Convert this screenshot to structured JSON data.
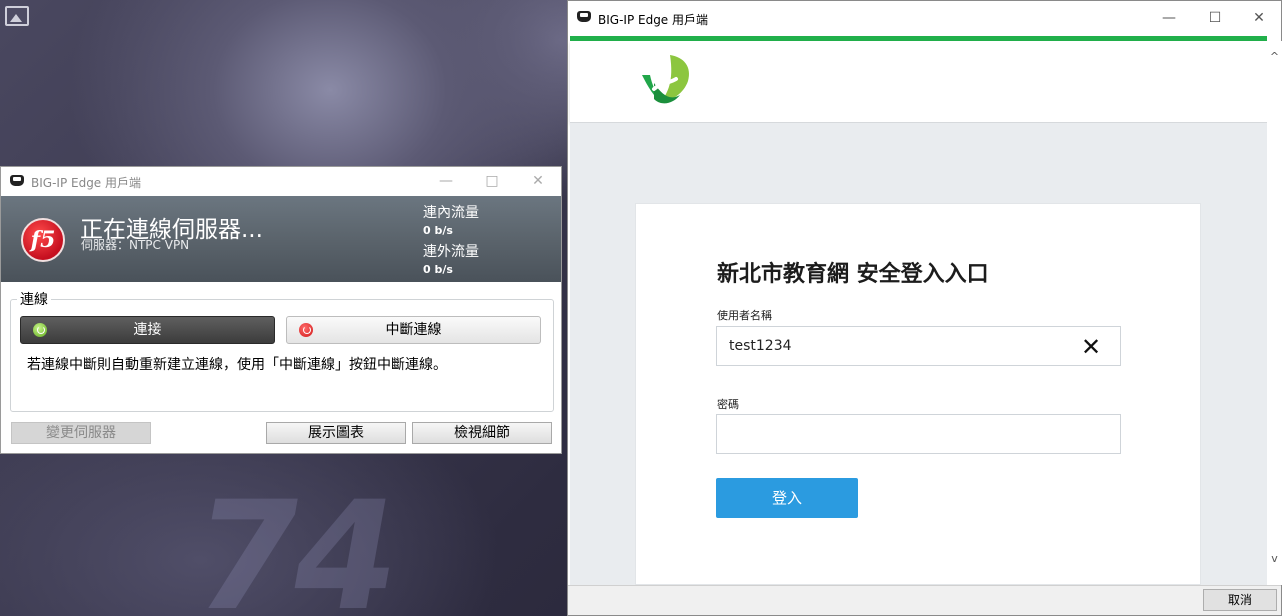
{
  "f5_window": {
    "title": "BIG-IP Edge 用戶端",
    "controls": {
      "minimize": "—",
      "maximize": "□",
      "close": "✕"
    },
    "logo_text": "f5",
    "status": "正在連線伺服器...",
    "server": "伺服器：NTPC VPN",
    "traffic": {
      "in_label": "連內流量",
      "in_value": "0 b/s",
      "out_label": "連外流量",
      "out_value": "0 b/s"
    },
    "group_label": "連線",
    "connect_label": "連接",
    "disconnect_label": "中斷連線",
    "note": "若連線中斷則自動重新建立連線，使用「中斷連線」按鈕中斷連線。",
    "buttons": {
      "change_server": "變更伺服器",
      "show_chart": "展示圖表",
      "view_details": "檢視細節"
    }
  },
  "login_window": {
    "title": "BIG-IP Edge 用戶端",
    "controls": {
      "minimize": "—",
      "maximize": "☐",
      "close": "✕"
    },
    "accent_color": "#21b04b",
    "heading": "新北市教育網 安全登入入口",
    "username_label": "使用者名稱",
    "username_value": "test1234",
    "clear_icon": "✕",
    "password_label": "密碼",
    "password_value": "",
    "login_button": "登入",
    "login_button_color": "#2b9be0",
    "scroll_up": "^",
    "scroll_down": "v",
    "cancel_button": "取消"
  },
  "wallpaper": {
    "numerals": "74"
  }
}
